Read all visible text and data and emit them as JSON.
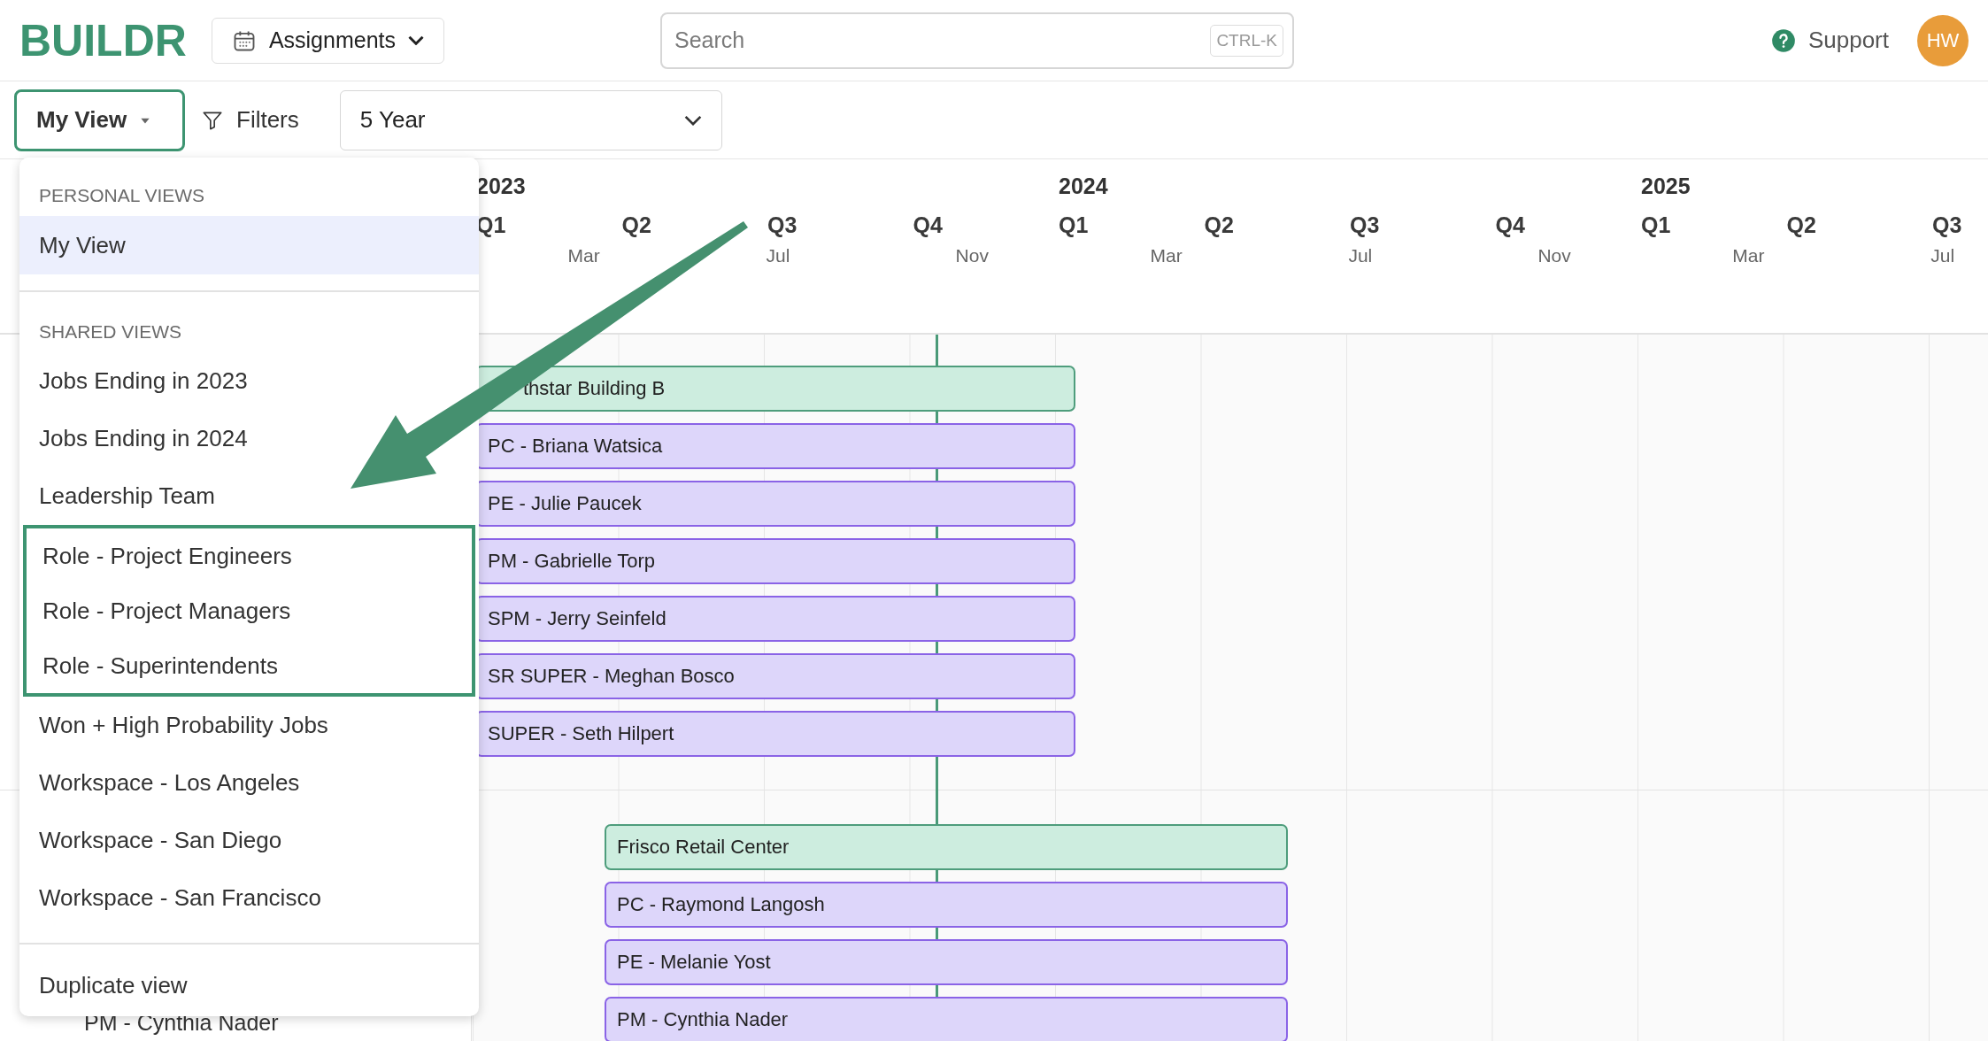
{
  "app": {
    "logo": "BUILDR",
    "module_button": "Assignments"
  },
  "search": {
    "placeholder": "Search",
    "shortcut": "CTRL-K"
  },
  "support": "Support",
  "avatar": {
    "initials": "HW"
  },
  "toolbar": {
    "view_button": "My View",
    "filters": "Filters",
    "range": "5 Year"
  },
  "timeline": {
    "quarters": [
      {
        "year": "2023",
        "label": "Q1"
      },
      {
        "label": "Q2"
      },
      {
        "label": "Q3"
      },
      {
        "label": "Q4"
      },
      {
        "year": "2024",
        "label": "Q1"
      },
      {
        "label": "Q2"
      },
      {
        "label": "Q3"
      },
      {
        "label": "Q4"
      },
      {
        "year": "2025",
        "label": "Q1"
      },
      {
        "label": "Q2"
      },
      {
        "label": "Q3"
      }
    ],
    "months": [
      "Mar",
      "Jul",
      "Nov",
      "Mar",
      "Jul",
      "Nov",
      "Mar",
      "Jul"
    ],
    "groups": [
      {
        "bars": [
          {
            "kind": "job",
            "label": "thstar Building B"
          },
          {
            "kind": "assignment",
            "label": "PC - Briana Watsica"
          },
          {
            "kind": "assignment",
            "label": "PE - Julie Paucek"
          },
          {
            "kind": "assignment",
            "label": "PM - Gabrielle Torp"
          },
          {
            "kind": "assignment",
            "label": "SPM - Jerry Seinfeld"
          },
          {
            "kind": "assignment",
            "label": "SR SUPER - Meghan Bosco"
          },
          {
            "kind": "assignment",
            "label": "SUPER - Seth Hilpert"
          }
        ]
      },
      {
        "left_label": "PM - Cynthia Nader",
        "bars": [
          {
            "kind": "job",
            "label": "Frisco Retail Center"
          },
          {
            "kind": "assignment",
            "label": "PC - Raymond Langosh"
          },
          {
            "kind": "assignment",
            "label": "PE - Melanie Yost"
          },
          {
            "kind": "assignment",
            "label": "PM - Cynthia Nader"
          }
        ]
      }
    ]
  },
  "view_menu": {
    "sections": [
      {
        "heading": "PERSONAL VIEWS",
        "items": [
          {
            "label": "My View",
            "selected": true,
            "highlighted": false
          }
        ]
      },
      {
        "heading": "SHARED VIEWS",
        "items": [
          {
            "label": "Jobs Ending in 2023",
            "selected": false,
            "highlighted": false
          },
          {
            "label": "Jobs Ending in 2024",
            "selected": false,
            "highlighted": false
          },
          {
            "label": "Leadership Team",
            "selected": false,
            "highlighted": false
          },
          {
            "label": "Role - Project Engineers",
            "selected": false,
            "highlighted": true
          },
          {
            "label": "Role - Project Managers",
            "selected": false,
            "highlighted": true
          },
          {
            "label": "Role - Superintendents",
            "selected": false,
            "highlighted": true
          },
          {
            "label": "Won + High Probability Jobs",
            "selected": false,
            "highlighted": false
          },
          {
            "label": "Workspace - Los Angeles",
            "selected": false,
            "highlighted": false
          },
          {
            "label": "Workspace - San Diego",
            "selected": false,
            "highlighted": false
          },
          {
            "label": "Workspace - San Francisco",
            "selected": false,
            "highlighted": false
          }
        ]
      }
    ],
    "action": "Duplicate view"
  }
}
